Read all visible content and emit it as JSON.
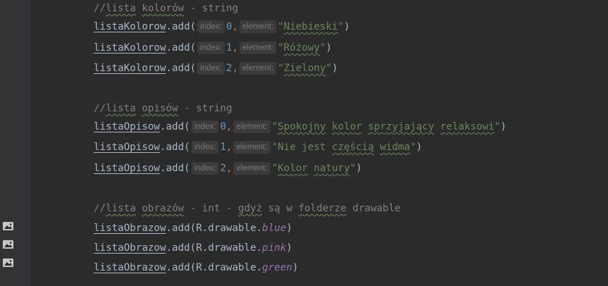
{
  "gutter": {
    "icons": [
      "image-resource-icon",
      "image-resource-icon",
      "image-resource-icon"
    ]
  },
  "code": {
    "c1": {
      "slashes": "//",
      "w1": "lista",
      "w2": "kolorów",
      "rest": " - string"
    },
    "kolory": {
      "var": "listaKolorow",
      "method": ".add(",
      "index_label": "index:",
      "element_label": "element:",
      "items": [
        {
          "idx": "0",
          "val": "Niebieski"
        },
        {
          "idx": "1",
          "val": "Różowy"
        },
        {
          "idx": "2",
          "val": "Zielony"
        }
      ]
    },
    "c2": {
      "slashes": "//",
      "w1": "lista",
      "w2": "opisów",
      "rest": " - string"
    },
    "opisy": {
      "var": "listaOpisow",
      "method": ".add(",
      "index_label": "index:",
      "element_label": "element:",
      "s0": {
        "w1": "Spokojny",
        "w2": "kolor",
        "w3": "sprzyjający",
        "w4": "relaksowi"
      },
      "s1": {
        "pre": "Nie jest ",
        "w1": "częścią",
        "w2": "widma"
      },
      "s2": {
        "w1": "Kolor",
        "w2": "natury"
      },
      "idx": [
        "0",
        "1",
        "2"
      ]
    },
    "c3": {
      "slashes": "//",
      "w1": "lista",
      "w2": "obrazów",
      "mid1": " - int - ",
      "w3": "gdyż",
      "mid2": " są w ",
      "w4": "folderze",
      "rest": " drawable"
    },
    "obrazy": {
      "var": "listaObrazow",
      "prefix": ".add(R.drawable.",
      "items": [
        "blue",
        "pink",
        "green"
      ],
      "close": ")"
    },
    "quote": "\"",
    "comma": ",",
    "close_paren": ")",
    "space": " "
  }
}
